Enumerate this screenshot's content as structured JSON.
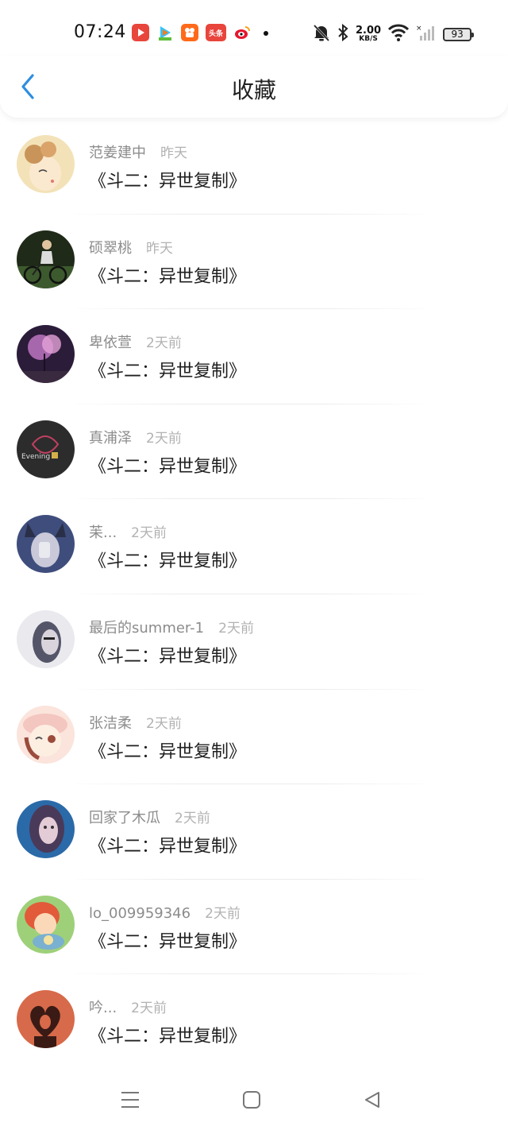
{
  "status_bar": {
    "time": "07:24",
    "apps": [
      {
        "icon": "video-app-icon",
        "color": "#e8463c",
        "label": "▶"
      },
      {
        "icon": "tencent-video-icon",
        "color": "#ffffff",
        "label": ""
      },
      {
        "icon": "kuaishou-icon",
        "color": "#ff6a1a",
        "label": ""
      },
      {
        "icon": "toutiao-icon",
        "color": "#e8453c",
        "label": "头条"
      },
      {
        "icon": "weibo-icon",
        "color": "#f7c51a",
        "label": ""
      }
    ],
    "net_speed_value": "2.00",
    "net_speed_unit": "KB/S",
    "battery": "93"
  },
  "header": {
    "title": "收藏",
    "accent_color": "#2e8ee0"
  },
  "items": [
    {
      "user": "范姜建中",
      "time": "昨天",
      "title": "《斗二：异世复制》",
      "avatar_colors": [
        "#f3e2b8",
        "#d9a36a"
      ]
    },
    {
      "user": "硕翠桃",
      "time": "昨天",
      "title": "《斗二：异世复制》",
      "avatar_colors": [
        "#3d5a2e",
        "#a9b39a"
      ]
    },
    {
      "user": "卑依萱",
      "time": "2天前",
      "title": "《斗二：异世复制》",
      "avatar_colors": [
        "#2b1c3a",
        "#c77ac9"
      ]
    },
    {
      "user": "真浦泽",
      "time": "2天前",
      "title": "《斗二：异世复制》",
      "avatar_colors": [
        "#2c2c2c",
        "#6a4e4a"
      ]
    },
    {
      "user": "苿...",
      "time": "2天前",
      "title": "《斗二：异世复制》",
      "avatar_colors": [
        "#3e4d7c",
        "#c9c9d9"
      ]
    },
    {
      "user": "最后的summer-1",
      "time": "2天前",
      "title": "《斗二：异世复制》",
      "avatar_colors": [
        "#e9e9ee",
        "#55556a"
      ]
    },
    {
      "user": "张洁柔",
      "time": "2天前",
      "title": "《斗二：异世复制》",
      "avatar_colors": [
        "#fbe4dc",
        "#9b4b3b"
      ]
    },
    {
      "user": "回家了木瓜",
      "time": "2天前",
      "title": "《斗二：异世复制》",
      "avatar_colors": [
        "#2b6aa8",
        "#c6a9c0"
      ]
    },
    {
      "user": "lo_009959346",
      "time": "2天前",
      "title": "《斗二：异世复制》",
      "avatar_colors": [
        "#e25a3a",
        "#7cc06a"
      ]
    },
    {
      "user": "吟...",
      "time": "2天前",
      "title": "《斗二：异世复制》",
      "avatar_colors": [
        "#d76a4a",
        "#3a1a14"
      ]
    }
  ],
  "nav": {
    "menu": "menu-icon",
    "home": "home-icon",
    "back": "back-triangle-icon"
  }
}
